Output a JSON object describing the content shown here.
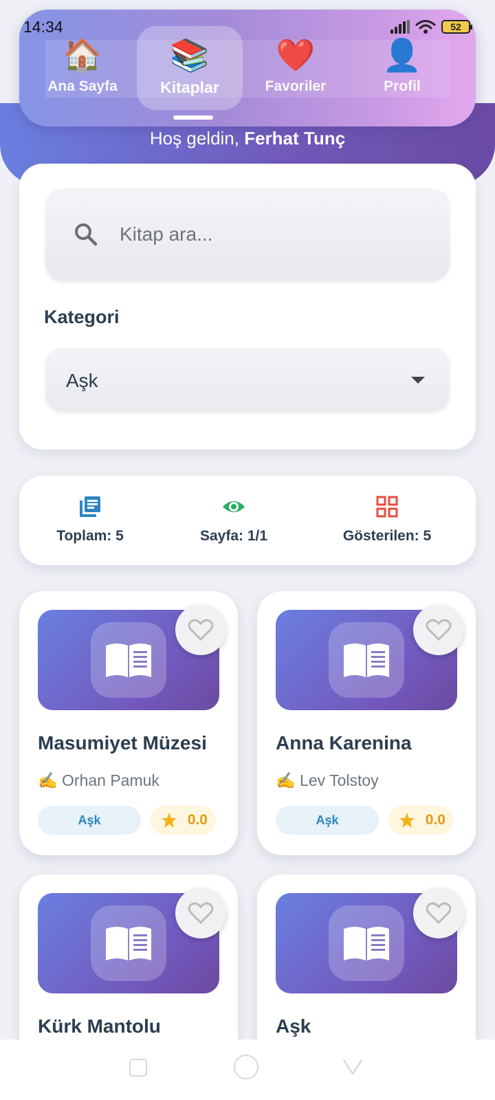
{
  "status_bar": {
    "time": "14:34",
    "battery": "52"
  },
  "nav": {
    "items": [
      {
        "label": "Ana Sayfa",
        "icon": "🏠",
        "active": false
      },
      {
        "label": "Kitaplar",
        "icon": "📚",
        "active": true
      },
      {
        "label": "Favoriler",
        "icon": "❤️",
        "active": false
      },
      {
        "label": "Profil",
        "icon": "👤",
        "active": false
      }
    ]
  },
  "welcome": {
    "prefix": "Hoş geldin, ",
    "name": "Ferhat Tunç"
  },
  "search": {
    "placeholder": "Kitap ara...",
    "value": ""
  },
  "category": {
    "label": "Kategori",
    "selected": "Aşk"
  },
  "stats": {
    "total": "Toplam: 5",
    "page": "Sayfa: 1/1",
    "shown": "Gösterilen: 5"
  },
  "books": [
    {
      "title": "Masumiyet Müzesi",
      "author": "✍️ Orhan Pamuk",
      "category": "Aşk",
      "rating": "0.0"
    },
    {
      "title": "Anna Karenina",
      "author": "✍️ Lev Tolstoy",
      "category": "Aşk",
      "rating": "0.0"
    },
    {
      "title": "Kürk Mantolu",
      "author": "",
      "category": "",
      "rating": ""
    },
    {
      "title": "Aşk",
      "author": "",
      "category": "",
      "rating": ""
    }
  ],
  "colors": {
    "accent_start": "#6a7fe0",
    "accent_end": "#6b4a9f",
    "category_text": "#2e86c1",
    "rating_text": "#e39b12",
    "stat_total_icon": "#2e86c1",
    "stat_page_icon": "#27ae60",
    "stat_shown_icon": "#e74c3c"
  }
}
